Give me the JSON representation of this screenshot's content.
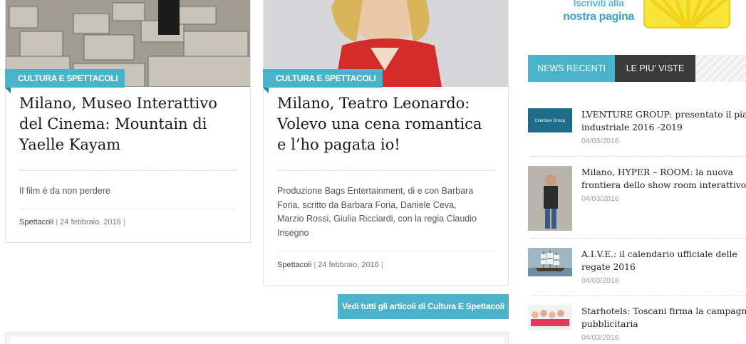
{
  "articles": [
    {
      "category": "CULTURA E SPETTACOLI",
      "title_lines": [
        "Milano, Museo Interattivo",
        "del Cinema: Mountain di",
        "Yaelle Kayam"
      ],
      "excerpt_lines": [
        "Il film è da non perdere"
      ],
      "section": "Spettacoli",
      "separator": "|",
      "date": "24 febbraio, 2016",
      "trailing": "|"
    },
    {
      "category": "CULTURA E SPETTACOLI",
      "title_lines": [
        "Milano, Teatro Leonardo:",
        "Volevo una cena romantica",
        "e l’ho pagata io!"
      ],
      "excerpt_lines": [
        "Produzione Bags Entertainment, di e con Barbara",
        "Foria, scritto da Barbara Foria, Daniele Ceva,",
        "Marzio Rossi, Giulia Ricciardi, con la regia Claudio",
        "Insegno"
      ],
      "section": "Spettacoli",
      "separator": "|",
      "date": "24 febbraio, 2016",
      "trailing": "|"
    }
  ],
  "more_button": "Vedi tutti gli articoli di Cultura E Spettacoli",
  "sidebar": {
    "subscribe_line1": "Iscriviti alla",
    "subscribe_line2": "nostra pagina",
    "tabs": [
      "NEWS RECENTI",
      "LE PIU' VISTE"
    ],
    "news": [
      {
        "title_lines": [
          "LVENTURE GROUP: presentato il piano",
          "industriale 2016 -2019"
        ],
        "date": "04/03/2016",
        "logo_text": "LVenture Group"
      },
      {
        "title_lines": [
          "Milano, HYPER – ROOM: la nuova",
          "frontiera dello show room interattivo"
        ],
        "date": "04/03/2016"
      },
      {
        "title_lines": [
          "A.I.V.E.: il calendario ufficiale delle",
          "regate 2016"
        ],
        "date": "04/03/2016"
      },
      {
        "title_lines": [
          "Starhotels: Toscani firma la campagna",
          "pubblicitaria"
        ],
        "date": "04/03/2016"
      }
    ]
  },
  "colors": {
    "accent": "#4bb3c9",
    "dark_tab": "#3a3a3a",
    "yellow_banner": "#f5e533"
  },
  "icons": [
    "category-tag-corner"
  ]
}
